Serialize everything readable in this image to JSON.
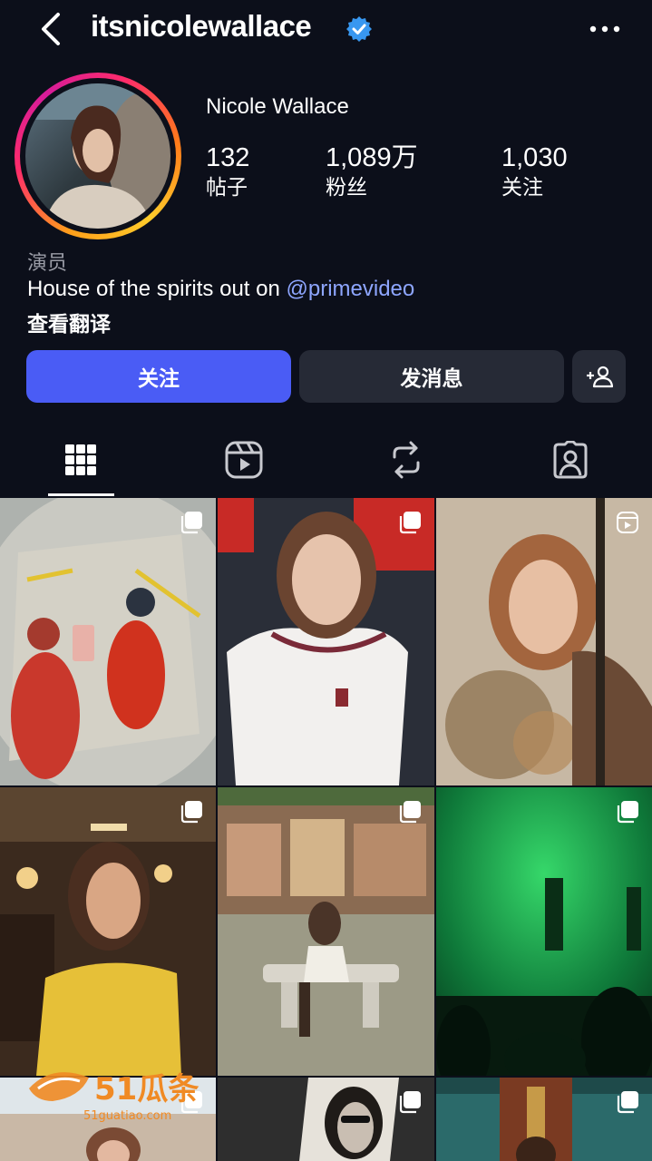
{
  "header": {
    "username": "itsnicolewallace",
    "back_icon": "chevron-left-icon",
    "verified_icon": "verified-badge-icon",
    "more_icon": "more-horizontal-icon",
    "verified_color": "#3897f0"
  },
  "profile": {
    "full_name": "Nicole Wallace",
    "stats": [
      {
        "value": "132",
        "label": "帖子"
      },
      {
        "value": "1,089万",
        "label": "粉丝"
      },
      {
        "value": "1,030",
        "label": "关注"
      }
    ],
    "category": "演员",
    "bio_text": "House of the spirits out on ",
    "bio_mention": "@primevideo",
    "translate_label": "查看翻译"
  },
  "actions": {
    "follow_label": "关注",
    "message_label": "发消息",
    "add_friend_icon": "add-person-icon",
    "accent_color": "#4a5cf5"
  },
  "tabs": [
    {
      "name": "grid",
      "icon": "grid-icon",
      "active": true
    },
    {
      "name": "reels",
      "icon": "reels-icon",
      "active": false
    },
    {
      "name": "reposts",
      "icon": "repost-icon",
      "active": false
    },
    {
      "name": "tagged",
      "icon": "tagged-person-icon",
      "active": false
    }
  ],
  "posts": [
    {
      "type": "carousel"
    },
    {
      "type": "carousel"
    },
    {
      "type": "reel"
    },
    {
      "type": "carousel"
    },
    {
      "type": "carousel"
    },
    {
      "type": "carousel"
    },
    {
      "type": "carousel"
    },
    {
      "type": "carousel"
    },
    {
      "type": "carousel"
    }
  ],
  "watermark": {
    "brand": "51瓜条",
    "url": "51guatiao.com"
  }
}
